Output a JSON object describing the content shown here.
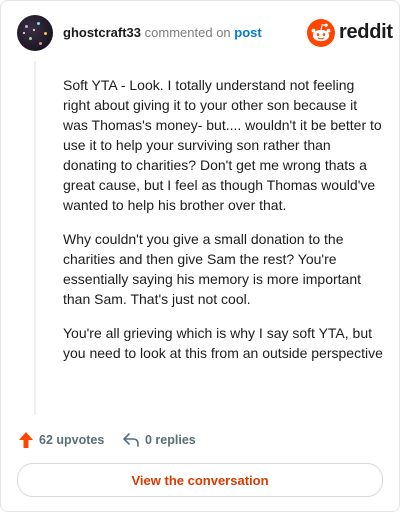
{
  "comment": {
    "username": "ghostcraft33",
    "action_text": "commented on",
    "post_link": "post",
    "paragraphs": [
      "Soft YTA - Look. I totally understand not feeling right about giving it to your other son because it was Thomas's money- but.... wouldn't it be better to use it to help your surviving son rather than donating to charities? Don't get me wrong thats a great cause, but I feel as though Thomas would've wanted to help his brother over that.",
      "Why couldn't you give a small donation to the charities and then give Sam the rest? You're essentially saying his memory is more important than Sam. That's just not cool.",
      "You're all grieving which is why I say soft YTA, but you need to look at this from an outside perspective"
    ],
    "upvotes": "62 upvotes",
    "replies": "0 replies"
  },
  "brand": {
    "logo_text": "reddit",
    "accent": "#ff4500"
  },
  "cta": {
    "label": "View the conversation"
  },
  "icons": {
    "upvote": "arrow-up-icon",
    "reply": "reply-arrow-icon",
    "logo": "reddit-snoo-icon"
  }
}
